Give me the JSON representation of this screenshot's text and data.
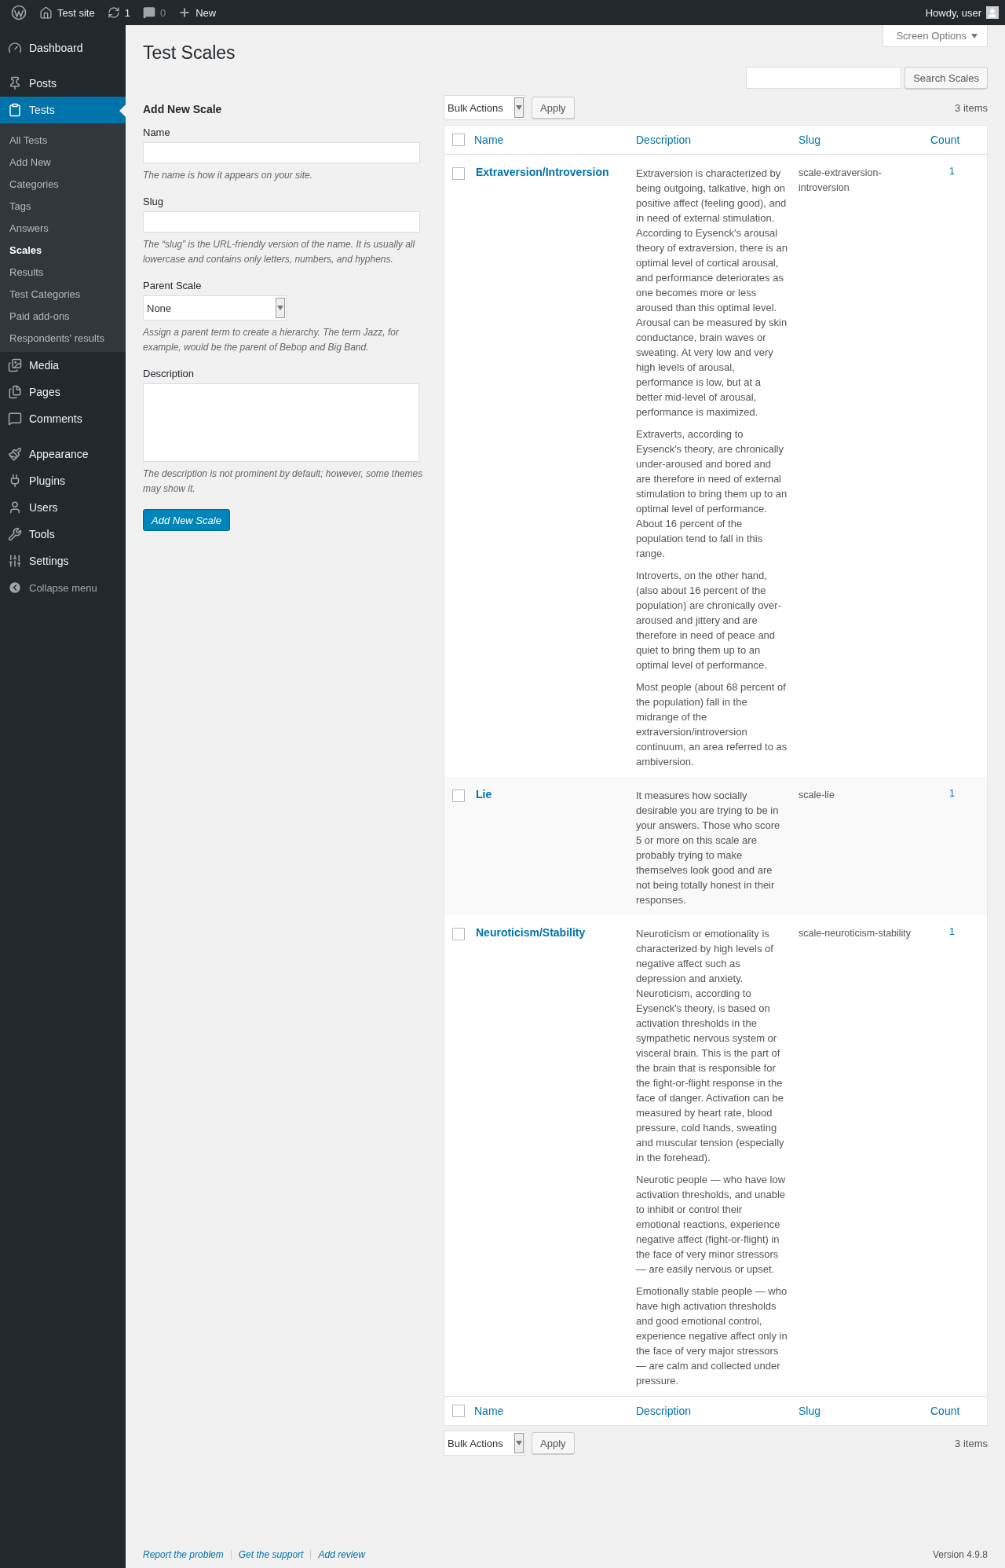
{
  "admin_bar": {
    "items": [
      {
        "kind": "logo"
      },
      {
        "kind": "home",
        "label": "Test site"
      },
      {
        "kind": "updates",
        "label": "1"
      },
      {
        "kind": "comments",
        "label": "0"
      },
      {
        "kind": "new",
        "label": "New"
      }
    ],
    "account": "Howdy, user"
  },
  "sidebar": {
    "items": [
      {
        "kind": "dashboard",
        "label": "Dashboard",
        "selected": false,
        "gap_after": true
      },
      {
        "kind": "posts",
        "label": "Posts",
        "selected": false
      },
      {
        "kind": "tests",
        "label": "Tests",
        "selected": true,
        "children": [
          {
            "label": "All Tests",
            "selected": false
          },
          {
            "label": "Add New",
            "selected": false
          },
          {
            "label": "Categories",
            "selected": false
          },
          {
            "label": "Tags",
            "selected": false
          },
          {
            "label": "Answers",
            "selected": false
          },
          {
            "label": "Scales",
            "selected": true
          },
          {
            "label": "Results",
            "selected": false
          },
          {
            "label": "Test Categories",
            "selected": false
          },
          {
            "label": "Paid add-ons",
            "selected": false
          },
          {
            "label": "Respondents' results",
            "selected": false
          }
        ]
      },
      {
        "kind": "media",
        "label": "Media",
        "selected": false
      },
      {
        "kind": "pages",
        "label": "Pages",
        "selected": false
      },
      {
        "kind": "comments",
        "label": "Comments",
        "selected": false,
        "gap_after": true
      },
      {
        "kind": "appearance",
        "label": "Appearance",
        "selected": false
      },
      {
        "kind": "plugins",
        "label": "Plugins",
        "selected": false
      },
      {
        "kind": "users",
        "label": "Users",
        "selected": false
      },
      {
        "kind": "tools",
        "label": "Tools",
        "selected": false
      },
      {
        "kind": "settings",
        "label": "Settings",
        "selected": false
      }
    ],
    "collapse": "Collapse menu"
  },
  "screen_options": "Screen Options",
  "page_title": "Test Scales",
  "search": {
    "button": "Search Scales"
  },
  "form": {
    "heading": "Add New Scale",
    "fields": [
      {
        "kind": "text",
        "label": "Name",
        "hint": "The name is how it appears on your site."
      },
      {
        "kind": "text",
        "label": "Slug",
        "hint": "The “slug” is the URL-friendly version of the name. It is usually all lowercase and contains only letters, numbers, and hyphens."
      },
      {
        "kind": "select",
        "label": "Parent Scale",
        "value": "None",
        "hint": "Assign a parent term to create a hierarchy. The term Jazz, for example, would be the parent of Bebop and Big Band."
      },
      {
        "kind": "textarea",
        "label": "Description",
        "hint": "The description is not prominent by default; however, some themes may show it."
      }
    ],
    "submit": "Add New Scale"
  },
  "tablenav_top": {
    "bulk_actions": "Bulk Actions",
    "apply": "Apply",
    "count": "3 items"
  },
  "table": {
    "header": {
      "checked": false,
      "columns": [
        "Name",
        "Description",
        "Slug",
        "Count"
      ]
    },
    "rows": [
      {
        "checked": false,
        "name": "Extraversion/Introversion",
        "description": [
          "Extraversion is characterized by being outgoing, talkative, high on positive affect (feeling good), and in need of external stimulation. According to Eysenck's arousal theory of extraversion, there is an optimal level of cortical arousal, and performance deteriorates as one becomes more or less aroused than this optimal level. Arousal can be measured by skin conductance, brain waves or sweating. At very low and very high levels of arousal, performance is low, but at a better mid-level of arousal, performance is maximized.",
          "Extraverts, according to Eysenck's theory, are chronically under-aroused and bored and are therefore in need of external stimulation to bring them up to an optimal level of performance. About 16 percent of the population tend to fall in this range.",
          "Introverts, on the other hand, (also about 16 percent of the population) are chronically over-aroused and jittery and are therefore in need of peace and quiet to bring them up to an optimal level of performance.",
          "Most people (about 68 percent of the population) fall in the midrange of the extraversion/introversion continuum, an area referred to as ambiversion."
        ],
        "slug": "scale-extraversion-introversion",
        "count": "1"
      },
      {
        "checked": false,
        "name": "Lie",
        "description": [
          "It measures how socially desirable you are trying to be in your answers. Those who score 5 or more on this scale are probably trying to make themselves look good and are not being totally honest in their responses."
        ],
        "slug": "scale-lie",
        "count": "1"
      },
      {
        "checked": false,
        "name": "Neuroticism/Stability",
        "description": [
          "Neuroticism or emotionality is characterized by high levels of negative affect such as depression and anxiety. Neuroticism, according to Eysenck's theory, is based on activation thresholds in the sympathetic nervous system or visceral brain. This is the part of the brain that is responsible for the fight-or-flight response in the face of danger. Activation can be measured by heart rate, blood pressure, cold hands, sweating and muscular tension (especially in the forehead).",
          "Neurotic people — who have low activation thresholds, and unable to inhibit or control their emotional reactions, experience negative affect (fight-or-flight) in the face of very minor stressors — are easily nervous or upset.",
          "Emotionally stable people — who have high activation thresholds and good emotional control, experience negative affect only in the face of very major stressors — are calm and collected under pressure."
        ],
        "slug": "scale-neuroticism-stability",
        "count": "1"
      }
    ],
    "footer": {
      "checked": false,
      "columns": [
        "Name",
        "Description",
        "Slug",
        "Count"
      ]
    }
  },
  "tablenav_bottom": {
    "bulk_actions": "Bulk Actions",
    "apply": "Apply",
    "count": "3 items"
  },
  "footer": {
    "links": [
      "Report the problem",
      "Get the support",
      "Add review"
    ],
    "version": "Version 4.9.8"
  }
}
